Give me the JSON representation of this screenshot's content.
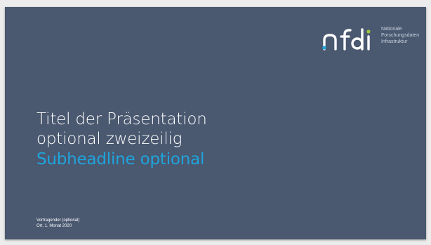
{
  "slide": {
    "title_line1": "Titel der Präsentation",
    "title_line2": "optional zweizeilig",
    "subheadline": "Subheadline optional",
    "presenter": "Vortragender (optional)",
    "place_date": "Ort, 1. Monat 2020",
    "background_color": "#4a5870",
    "accent_color": "#1fa4dc"
  },
  "logo": {
    "wordmark": "nfdi",
    "tagline_line1": "Nationale",
    "tagline_line2": "Forschungsdaten",
    "tagline_line3": "Infrastruktur"
  }
}
